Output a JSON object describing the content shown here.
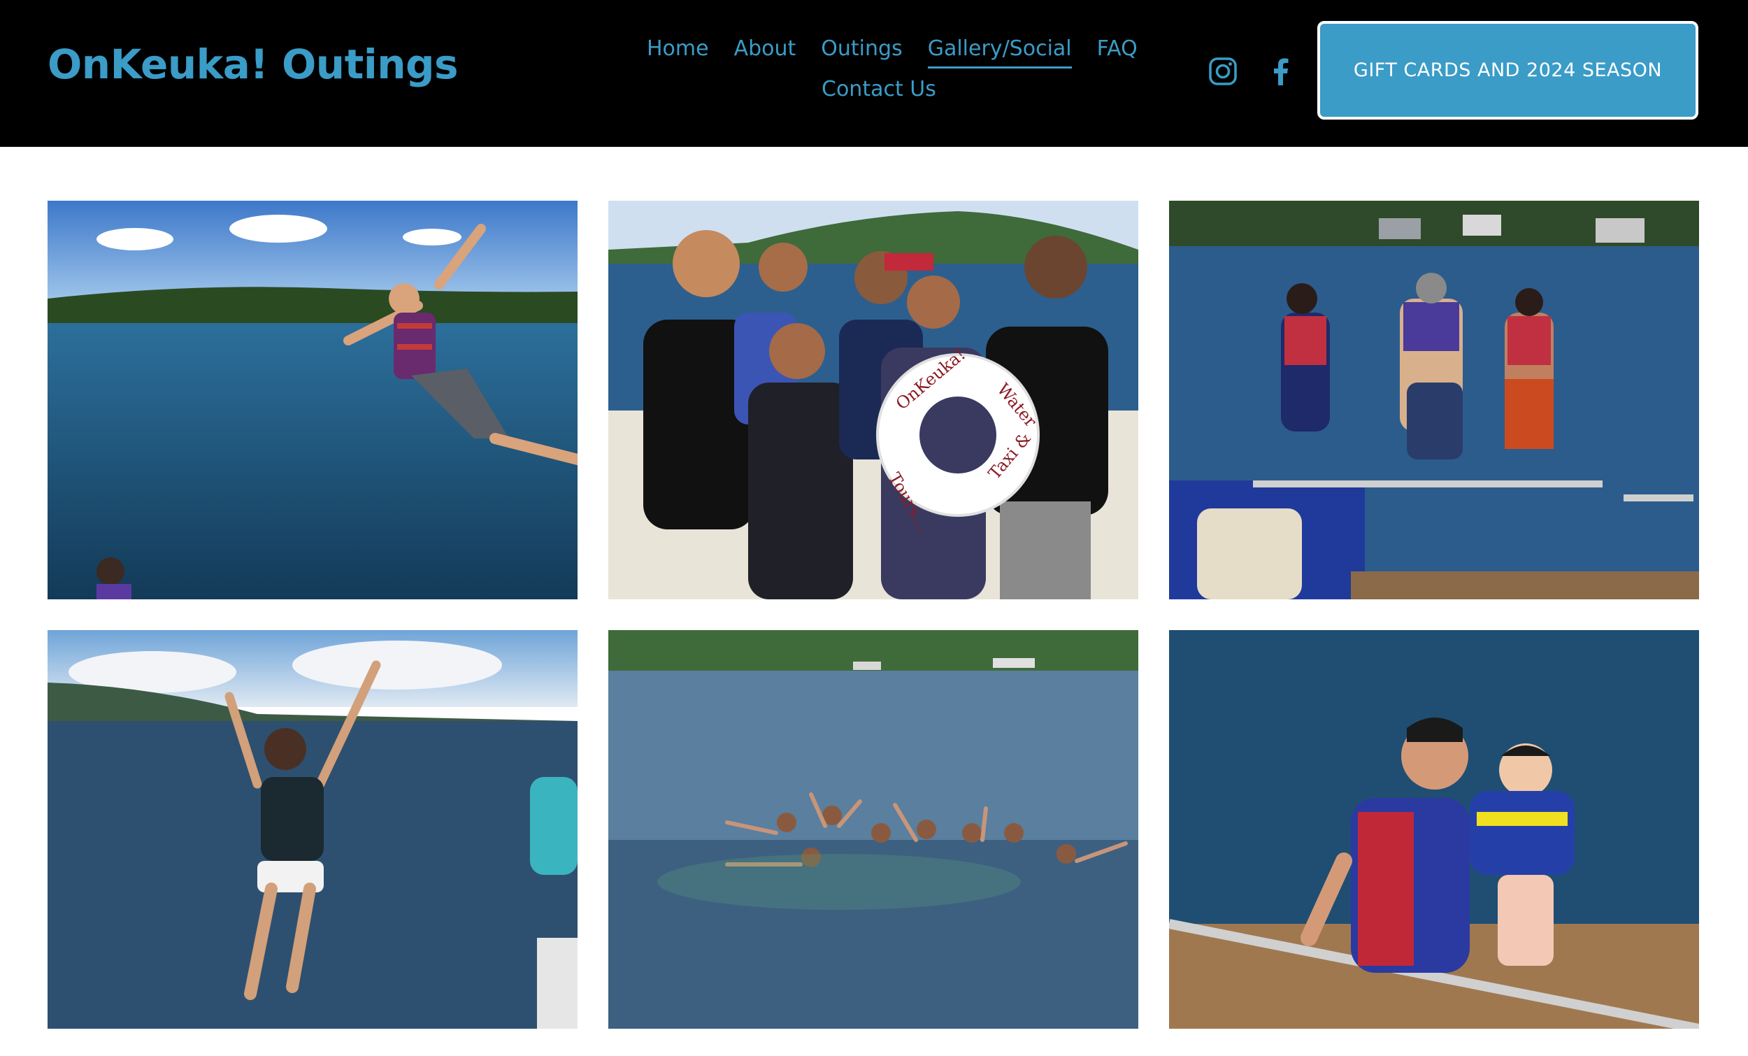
{
  "site": {
    "title": "OnKeuka! Outings"
  },
  "nav": {
    "items": [
      {
        "label": "Home"
      },
      {
        "label": "About"
      },
      {
        "label": "Outings"
      },
      {
        "label": "Gallery/Social",
        "active": true
      },
      {
        "label": "FAQ"
      },
      {
        "label": "Contact Us"
      }
    ]
  },
  "social": {
    "instagram_icon": "instagram-icon",
    "facebook_icon": "facebook-icon"
  },
  "cta": {
    "label": "GIFT CARDS AND 2024 SEASON"
  },
  "gallery": {
    "photos": [
      {
        "scene": "man-jumping-off-boat-into-lake"
      },
      {
        "scene": "family-group-with-life-ring-on-boat",
        "life_ring_text": "OnKeuka! Water Taxi & Tours..."
      },
      {
        "scene": "three-people-jumping-off-pontoon"
      },
      {
        "scene": "woman-jumping-into-lake"
      },
      {
        "scene": "group-swimming-in-lake"
      },
      {
        "scene": "man-holding-baby-on-pontoon"
      }
    ]
  },
  "colors": {
    "accent": "#3a9cc7",
    "header_bg": "#000000",
    "page_bg": "#ffffff",
    "water": "#1f4f73",
    "sky": "#6fa4d8"
  }
}
